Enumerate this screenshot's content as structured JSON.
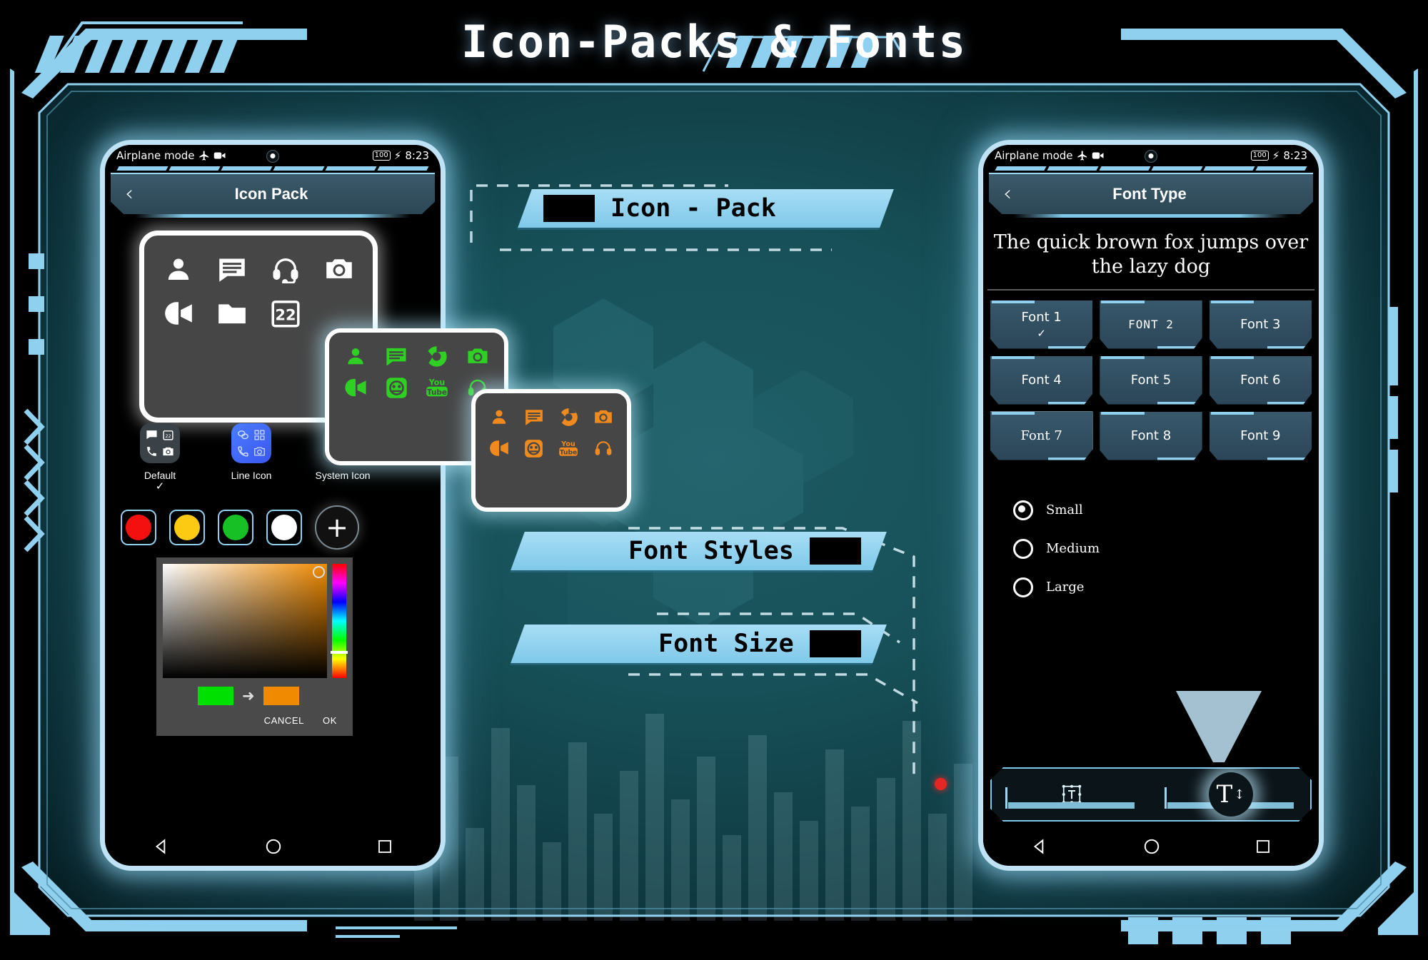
{
  "page": {
    "title": "Icon-Packs & Fonts",
    "accent": "#8fd0ef",
    "panel_bg": "#175058"
  },
  "callouts": [
    {
      "id": "icon-pack",
      "label": "Icon - Pack",
      "block_side": "left"
    },
    {
      "id": "font-styles",
      "label": "Font Styles",
      "block_side": "right"
    },
    {
      "id": "font-size",
      "label": "Font Size",
      "block_side": "right"
    }
  ],
  "left_phone": {
    "status_bar": {
      "left_text": "Airplane mode",
      "airplane_icon": "airplane-icon",
      "record_icon": "video-record-icon",
      "battery": "100",
      "charging_icon": "bolt-icon",
      "time": "8:23"
    },
    "app_bar": {
      "back_icon": "chevron-left-icon",
      "title": "Icon Pack"
    },
    "preview_card": {
      "icons": [
        "contact-icon",
        "message-icon",
        "headset-icon",
        "camera-icon",
        "video-call-icon",
        "folder-icon",
        "calendar-icon"
      ],
      "calendar_day": "22"
    },
    "packs": [
      {
        "label": "Default",
        "selected": true,
        "check": "✓",
        "tile_color": "#3a4248",
        "icon_color": "#ffffff"
      },
      {
        "label": "Line Icon",
        "selected": false,
        "check": "",
        "tile_color": "#3d6bf5",
        "icon_color": "#cfe0ff"
      },
      {
        "label": "System Icon",
        "selected": false,
        "check": "",
        "tile_color": "#404040",
        "icon_color": "#ffffff"
      }
    ],
    "swatches": [
      {
        "name": "red",
        "hex": "#f51010"
      },
      {
        "name": "yellow",
        "hex": "#fcc913"
      },
      {
        "name": "green",
        "hex": "#17c024"
      },
      {
        "name": "white",
        "hex": "#ffffff"
      }
    ],
    "add_color_button": "+",
    "color_picker": {
      "current_color": "#00e000",
      "new_color": "#f08a00",
      "arrow": "➜",
      "cancel_label": "CANCEL",
      "ok_label": "OK"
    },
    "nav_bar": {
      "back": "back-triangle-icon",
      "home": "home-circle-icon",
      "recents": "recents-square-icon"
    }
  },
  "float_cards": [
    {
      "id": "green-pack",
      "icon_color": "#2fd024",
      "icons": [
        "contact-icon",
        "message-icon",
        "chrome-icon",
        "camera-icon",
        "video-call-icon",
        "duo-icon",
        "youtube-icon",
        "headset-icon"
      ],
      "youtube_top": "You",
      "youtube_bottom": "Tube"
    },
    {
      "id": "orange-pack",
      "icon_color": "#f08a1e",
      "icons": [
        "contact-icon",
        "message-icon",
        "chrome-icon",
        "camera-icon",
        "video-call-icon",
        "duo-icon",
        "youtube-icon",
        "headset-icon"
      ],
      "youtube_top": "You",
      "youtube_bottom": "Tube"
    }
  ],
  "right_phone": {
    "status_bar": {
      "left_text": "Airplane mode",
      "airplane_icon": "airplane-icon",
      "record_icon": "video-record-icon",
      "battery": "100",
      "charging_icon": "bolt-icon",
      "time": "8:23"
    },
    "app_bar": {
      "back_icon": "chevron-left-icon",
      "title": "Font Type"
    },
    "preview_text": "The quick brown fox jumps over the lazy dog",
    "fonts": [
      {
        "label": "Font 1",
        "selected": true,
        "check": "✓",
        "highlight": false
      },
      {
        "label": "FONT 2",
        "selected": false,
        "check": "",
        "highlight": false
      },
      {
        "label": "Font 3",
        "selected": false,
        "check": "",
        "highlight": false
      },
      {
        "label": "Font 4",
        "selected": false,
        "check": "",
        "highlight": false
      },
      {
        "label": "Font 5",
        "selected": false,
        "check": "",
        "highlight": false
      },
      {
        "label": "Font 6",
        "selected": false,
        "check": "",
        "highlight": false
      },
      {
        "label": "Font 7",
        "selected": false,
        "check": "",
        "highlight": true
      },
      {
        "label": "Font 8",
        "selected": false,
        "check": "",
        "highlight": false
      },
      {
        "label": "Font 9",
        "selected": false,
        "check": "",
        "highlight": false
      }
    ],
    "sizes": [
      {
        "label": "Small",
        "selected": true
      },
      {
        "label": "Medium",
        "selected": false
      },
      {
        "label": "Large",
        "selected": false
      }
    ],
    "bottom_bar": {
      "font_type_tab": "font-type-icon",
      "font_size_tab": "font-size-icon",
      "font_size_glyph": "T"
    },
    "nav_bar": {
      "back": "back-triangle-icon",
      "home": "home-circle-icon",
      "recents": "recents-square-icon"
    }
  }
}
